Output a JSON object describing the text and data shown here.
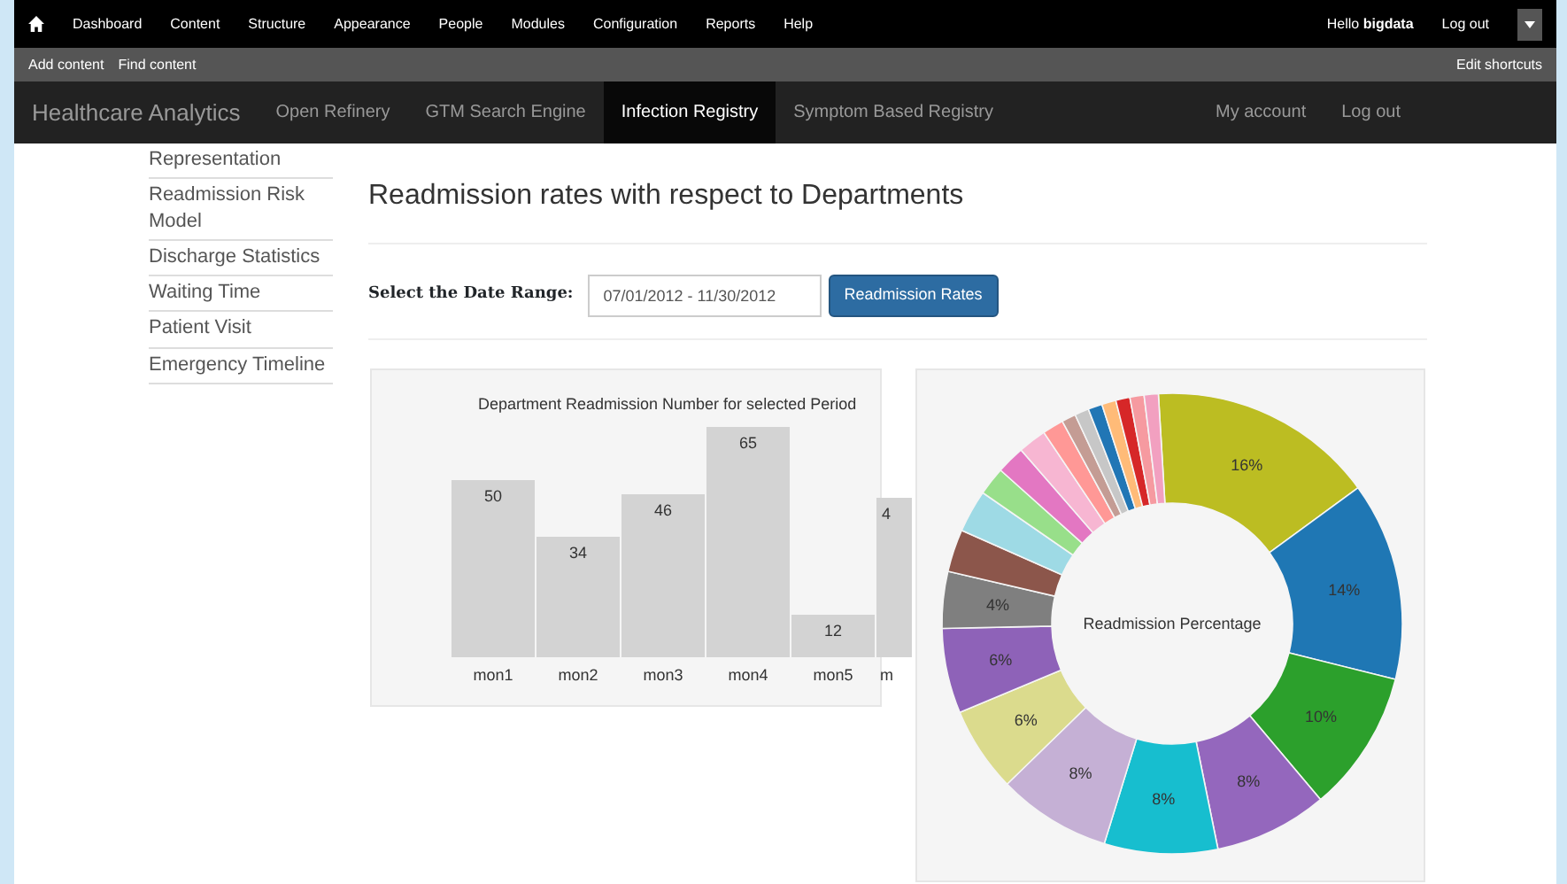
{
  "admin_toolbar": {
    "menu": [
      {
        "label": "Dashboard"
      },
      {
        "label": "Content"
      },
      {
        "label": "Structure"
      },
      {
        "label": "Appearance"
      },
      {
        "label": "People"
      },
      {
        "label": "Modules"
      },
      {
        "label": "Configuration"
      },
      {
        "label": "Reports"
      },
      {
        "label": "Help"
      }
    ],
    "greeting": "Hello **bigdata**",
    "logout": "Log out"
  },
  "shortcuts": {
    "items": [
      "Add content",
      "Find content"
    ],
    "edit": "Edit shortcuts"
  },
  "navbar": {
    "brand": "Healthcare Analytics",
    "items": [
      {
        "label": "Open Refinery",
        "selected": false
      },
      {
        "label": "GTM Search Engine",
        "selected": false
      },
      {
        "label": "Infection Registry",
        "selected": true
      },
      {
        "label": "Symptom Based Registry",
        "selected": false
      }
    ],
    "right": [
      "My account",
      "Log out"
    ]
  },
  "sidebar": {
    "items": [
      "Representation",
      "Readmission Risk Model",
      "Discharge Statistics",
      "Waiting Time",
      "Patient Visit",
      "Emergency Timeline"
    ]
  },
  "heading": "Readmission rates with respect to Departments",
  "date_range": {
    "label": "Select the Date Range:",
    "value": "07/01/2012 - 11/30/2012",
    "button": "Readmission Rates"
  },
  "bar_chart": {
    "chart_data": {
      "type": "bar",
      "title": "Department Readmission Number for selected Period",
      "categories": [
        "mon1",
        "mon2",
        "mon3",
        "mon4",
        "mon5",
        "m"
      ],
      "values": [
        50,
        34,
        46,
        65,
        12,
        null
      ],
      "data_labels": true
    },
    "cut_bar_label": "4"
  },
  "pie_chart": {
    "chart_data": {
      "type": "donut",
      "title": "Readmission Percentage",
      "values": [
        16,
        14,
        10,
        8,
        8,
        8,
        6,
        6,
        4,
        3,
        3,
        2,
        2,
        2,
        1.5,
        1,
        1,
        1,
        1,
        1,
        1,
        1
      ],
      "colors": [
        "#bcbd22",
        "#1f77b4",
        "#2ca02c",
        "#9467bd",
        "#17becf",
        "#c5b0d5",
        "#dbdb8d",
        "#8e62b8",
        "#7f7f7f",
        "#8c564b",
        "#9edae5",
        "#98df8a",
        "#e377c2",
        "#f7b6d2",
        "#ff9896",
        "#c49c94",
        "#c7c7c7",
        "#2176b5",
        "#ffbb78",
        "#d62728",
        "#f69aa0",
        "#f2a0c0"
      ],
      "value_labels": [
        "16%",
        "14%",
        "10%",
        "8%",
        "8%",
        "8%",
        "6%",
        "6%",
        "4%",
        null,
        null,
        null,
        null,
        null,
        null,
        null,
        null,
        null,
        null,
        null,
        null,
        null
      ]
    }
  }
}
